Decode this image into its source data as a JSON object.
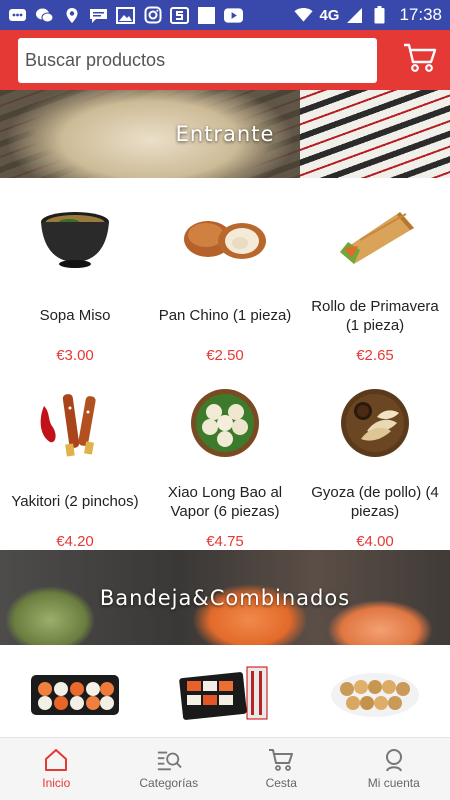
{
  "status_bar": {
    "network": "4G",
    "time": "17:38",
    "icons": [
      "chat-icon",
      "wechat-icon",
      "location-icon",
      "message-icon",
      "image-icon",
      "instagram-icon",
      "s-app-icon",
      "blank-app-icon",
      "youtube-icon",
      "wifi-icon",
      "signal-icon",
      "battery-icon"
    ]
  },
  "header": {
    "search_placeholder": "Buscar productos",
    "cart_icon": "cart-icon"
  },
  "categories": [
    {
      "title": "Entrante",
      "products": [
        {
          "name": "Sopa Miso",
          "price": "€3.00",
          "image": "miso-soup-bowl"
        },
        {
          "name": "Pan Chino (1 pieza)",
          "price": "€2.50",
          "image": "chinese-bun"
        },
        {
          "name": "Rollo de Primavera (1 pieza)",
          "price": "€2.65",
          "image": "spring-roll"
        },
        {
          "name": "Yakitori (2 pinchos)",
          "price": "€4.20",
          "image": "yakitori-skewers"
        },
        {
          "name": "Xiao Long Bao al Vapor (6 piezas)",
          "price": "€4.75",
          "image": "xiao-long-bao"
        },
        {
          "name": "Gyoza (de pollo) (4 piezas)",
          "price": "€4.00",
          "image": "gyoza-plate"
        }
      ]
    },
    {
      "title": "Bandeja&Combinados",
      "products": [
        {
          "image": "sushi-tray"
        },
        {
          "image": "sushi-combo-box"
        },
        {
          "image": "sushi-rolls-plate"
        }
      ]
    }
  ],
  "bottom_nav": [
    {
      "label": "Inicio",
      "icon": "home-icon",
      "active": true
    },
    {
      "label": "Categorías",
      "icon": "categories-search-icon",
      "active": false
    },
    {
      "label": "Cesta",
      "icon": "cart-icon",
      "active": false
    },
    {
      "label": "Mi cuenta",
      "icon": "user-icon",
      "active": false
    }
  ],
  "colors": {
    "status_bar": "#3949ab",
    "accent": "#e53935",
    "nav_background": "#f5f5f5"
  }
}
